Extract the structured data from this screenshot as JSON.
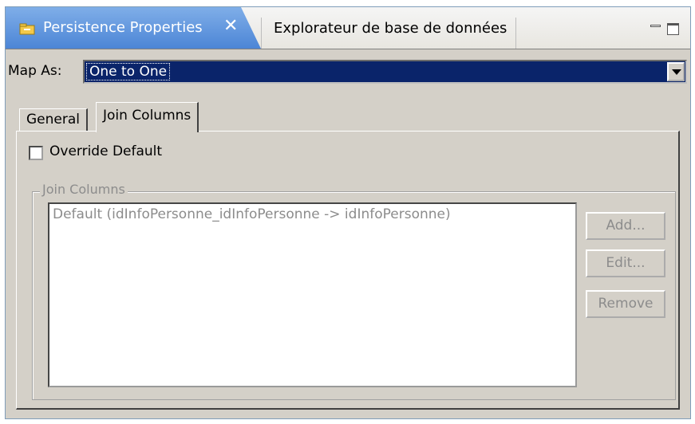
{
  "view_tabs": {
    "active": {
      "label": "Persistence Properties",
      "close": "✕"
    },
    "inactive": {
      "label": "Explorateur de base de données"
    }
  },
  "map_as": {
    "label": "Map As:",
    "value": "One to One"
  },
  "tabs": [
    {
      "label": "General",
      "selected": false
    },
    {
      "label": "Join Columns",
      "selected": true
    }
  ],
  "override_default": {
    "label": "Override Default",
    "checked": false
  },
  "join_columns": {
    "group_title": "Join Columns",
    "items": [
      "Default (idInfoPersonne_idInfoPersonne -> idInfoPersonne)"
    ],
    "buttons": {
      "add": "Add...",
      "edit": "Edit...",
      "remove": "Remove"
    }
  },
  "colors": {
    "active_tab": "#4c85d6",
    "selection": "#0a246a",
    "panel_bg": "#d4d0c8",
    "disabled_text": "#8c8c8c"
  }
}
